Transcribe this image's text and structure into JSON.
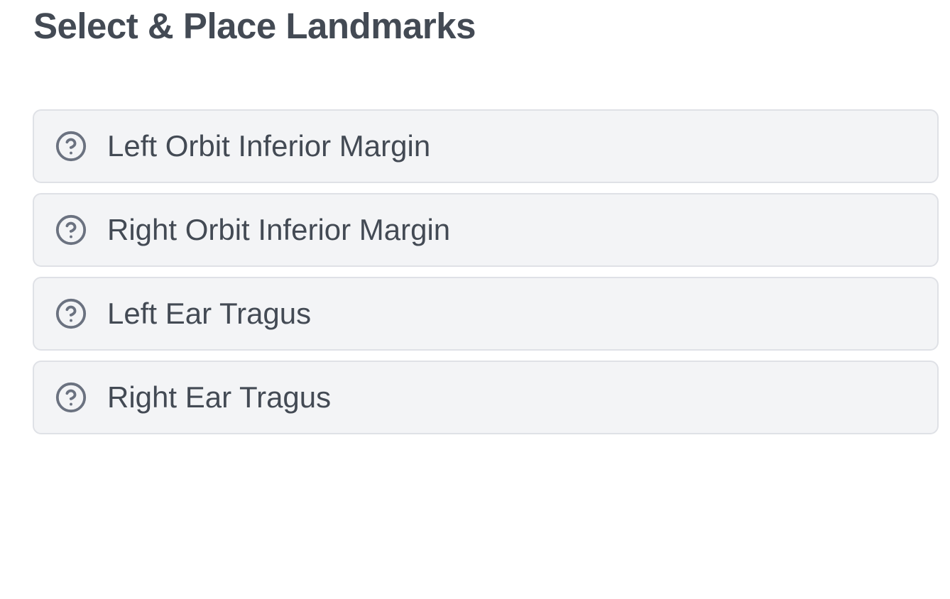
{
  "header": {
    "title": "Select & Place Landmarks"
  },
  "landmarks": {
    "items": [
      {
        "label": "Left Orbit Inferior Margin",
        "icon": "question-circle-icon"
      },
      {
        "label": "Right Orbit Inferior Margin",
        "icon": "question-circle-icon"
      },
      {
        "label": "Left Ear Tragus",
        "icon": "question-circle-icon"
      },
      {
        "label": "Right Ear Tragus",
        "icon": "question-circle-icon"
      }
    ]
  },
  "colors": {
    "text": "#434a54",
    "icon": "#6b7280",
    "item_background": "#f3f4f6",
    "item_border": "#dfe1e6"
  }
}
